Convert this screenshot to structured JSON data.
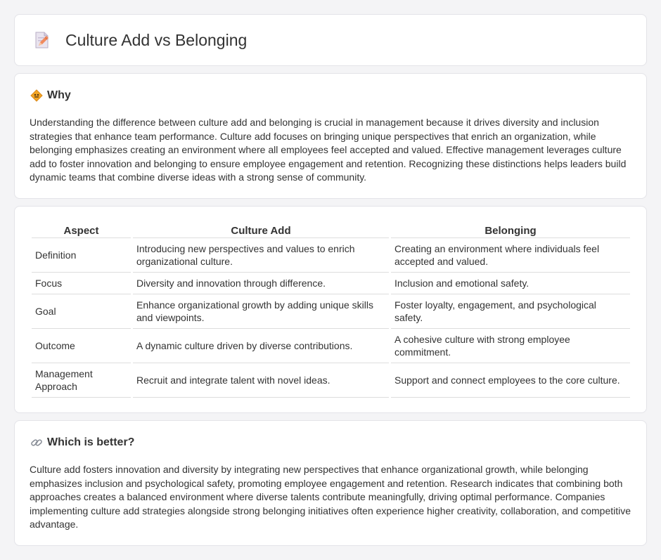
{
  "header": {
    "title": "Culture Add vs Belonging",
    "icon": "edit-document-icon"
  },
  "why": {
    "icon": "diamond-sign-icon",
    "title": "Why",
    "body": "Understanding the difference between culture add and belonging is crucial in management because it drives diversity and inclusion strategies that enhance team performance. Culture add focuses on bringing unique perspectives that enrich an organization, while belonging emphasizes creating an environment where all employees feel accepted and valued. Effective management leverages culture add to foster innovation and belonging to ensure employee engagement and retention. Recognizing these distinctions helps leaders build dynamic teams that combine diverse ideas with a strong sense of community."
  },
  "table": {
    "headers": [
      "Aspect",
      "Culture Add",
      "Belonging"
    ],
    "rows": [
      [
        "Definition",
        "Introducing new perspectives and values to enrich organizational culture.",
        "Creating an environment where individuals feel accepted and valued."
      ],
      [
        "Focus",
        "Diversity and innovation through difference.",
        "Inclusion and emotional safety."
      ],
      [
        "Goal",
        "Enhance organizational growth by adding unique skills and viewpoints.",
        "Foster loyalty, engagement, and psychological safety."
      ],
      [
        "Outcome",
        "A dynamic culture driven by diverse contributions.",
        "A cohesive culture with strong employee commitment."
      ],
      [
        "Management Approach",
        "Recruit and integrate talent with novel ideas.",
        "Support and connect employees to the core culture."
      ]
    ]
  },
  "better": {
    "icon": "link-icon",
    "title": "Which is better?",
    "body": "Culture add fosters innovation and diversity by integrating new perspectives that enhance organizational growth, while belonging emphasizes inclusion and psychological safety, promoting employee engagement and retention. Research indicates that combining both approaches creates a balanced environment where diverse talents contribute meaningfully, driving optimal performance. Companies implementing culture add strategies alongside strong belonging initiatives often experience higher creativity, collaboration, and competitive advantage."
  },
  "colors": {
    "background": "#f4f4f6",
    "card": "#ffffff",
    "accent": "#f0a030"
  }
}
